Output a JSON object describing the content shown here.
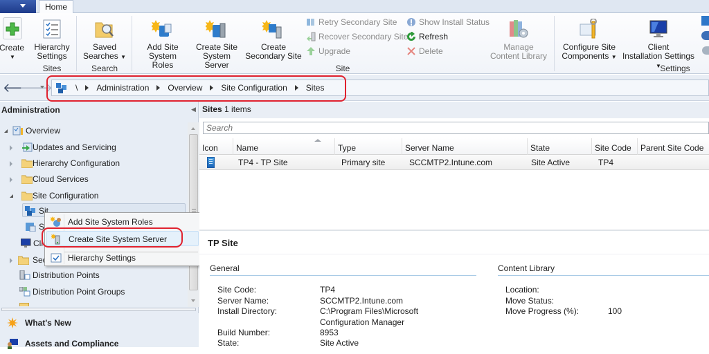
{
  "ribbon": {
    "tabs": [
      {
        "label": "Home",
        "active": true
      }
    ],
    "buttons": {
      "create": "Create",
      "hierarchy_settings_1": "Hierarchy",
      "hierarchy_settings_2": "Settings",
      "saved_searches_1": "Saved",
      "saved_searches_2": "Searches",
      "add_site_roles_1": "Add Site",
      "add_site_roles_2": "System Roles",
      "create_site_server_1": "Create Site",
      "create_site_server_2": "System Server",
      "create_secondary_1": "Create",
      "create_secondary_2": "Secondary Site",
      "retry_secondary": "Retry Secondary Site",
      "recover_secondary": "Recover Secondary Site",
      "upgrade": "Upgrade",
      "show_install_status": "Show Install Status",
      "refresh": "Refresh",
      "delete": "Delete",
      "manage_content_1": "Manage",
      "manage_content_2": "Content Library",
      "configure_components_1": "Configure Site",
      "configure_components_2": "Components",
      "client_install_1": "Client",
      "client_install_2": "Installation Settings"
    },
    "groups": {
      "sites": "Sites",
      "search": "Search",
      "site": "Site",
      "settings": "Settings"
    }
  },
  "breadcrumb": {
    "root": "\\",
    "items": [
      "Administration",
      "Overview",
      "Site Configuration",
      "Sites"
    ]
  },
  "nav": {
    "title": "Administration",
    "tree": [
      {
        "label": "Overview",
        "expanded": true
      },
      {
        "label": "Updates and Servicing"
      },
      {
        "label": "Hierarchy Configuration"
      },
      {
        "label": "Cloud Services"
      },
      {
        "label": "Site Configuration",
        "expanded": true
      },
      {
        "label": "Sit"
      },
      {
        "label": "S"
      },
      {
        "label": "Cli"
      },
      {
        "label": "Sec"
      },
      {
        "label": "Distribution Points"
      },
      {
        "label": "Distribution Point Groups"
      }
    ],
    "wunderbar": [
      {
        "label": "What's New"
      },
      {
        "label": "Assets and Compliance"
      }
    ]
  },
  "context_menu": {
    "items": [
      {
        "label": "Add Site System Roles"
      },
      {
        "label": "Create Site System Server",
        "highlighted": true
      },
      {
        "label": "Hierarchy Settings"
      }
    ]
  },
  "list": {
    "title": "Sites",
    "count": "1 items",
    "search_placeholder": "Search",
    "columns": [
      "Icon",
      "Name",
      "Type",
      "Server Name",
      "State",
      "Site Code",
      "Parent Site Code"
    ],
    "rows": [
      {
        "name": "TP4 - TP Site",
        "type": "Primary site",
        "server": "SCCMTP2.Intune.com",
        "state": "Site Active",
        "site_code": "TP4",
        "parent": ""
      }
    ]
  },
  "details": {
    "title": "TP Site",
    "general": {
      "title": "General",
      "fields": [
        {
          "label": "Site Code:",
          "value": "TP4"
        },
        {
          "label": "Server Name:",
          "value": "SCCMTP2.Intune.com"
        },
        {
          "label": "Install Directory:",
          "value": "C:\\Program Files\\Microsoft",
          "value2": "Configuration Manager"
        },
        {
          "label": "Build Number:",
          "value": "8953"
        },
        {
          "label": "State:",
          "value": "Site Active"
        }
      ]
    },
    "content_library": {
      "title": "Content Library",
      "fields": [
        {
          "label": "Location:",
          "value": ""
        },
        {
          "label": "Move Status:",
          "value": ""
        },
        {
          "label": "Move Progress (%):",
          "value": "100"
        }
      ]
    }
  },
  "colors": {
    "highlight_outline": "#e0212e",
    "accent_blue": "#1d3a8a"
  }
}
